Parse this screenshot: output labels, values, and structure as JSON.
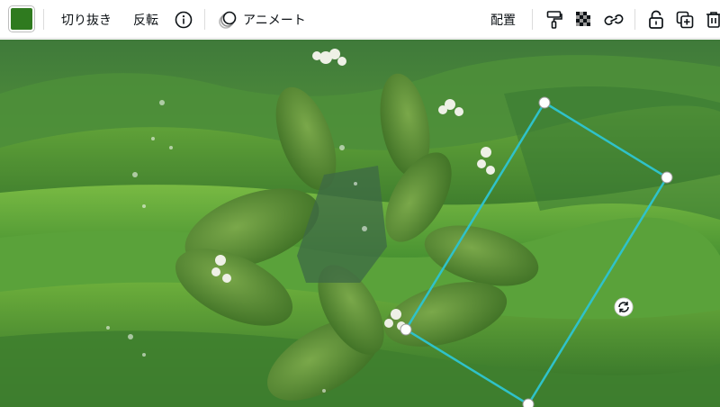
{
  "toolbar": {
    "color_swatch": "#2f7a1f",
    "crop_label": "切り抜き",
    "flip_label": "反転",
    "animate_label": "アニメート",
    "position_label": "配置",
    "icons": [
      "info-icon",
      "animate-icon",
      "paint-roller-icon",
      "transparency-icon",
      "link-icon",
      "lock-icon",
      "duplicate-icon",
      "trash-icon"
    ]
  },
  "canvas": {
    "accent": "#2fc2c9",
    "sky": "#3f7a3a",
    "hills": "#4e9a33",
    "leaf": "#4a8a2c"
  }
}
